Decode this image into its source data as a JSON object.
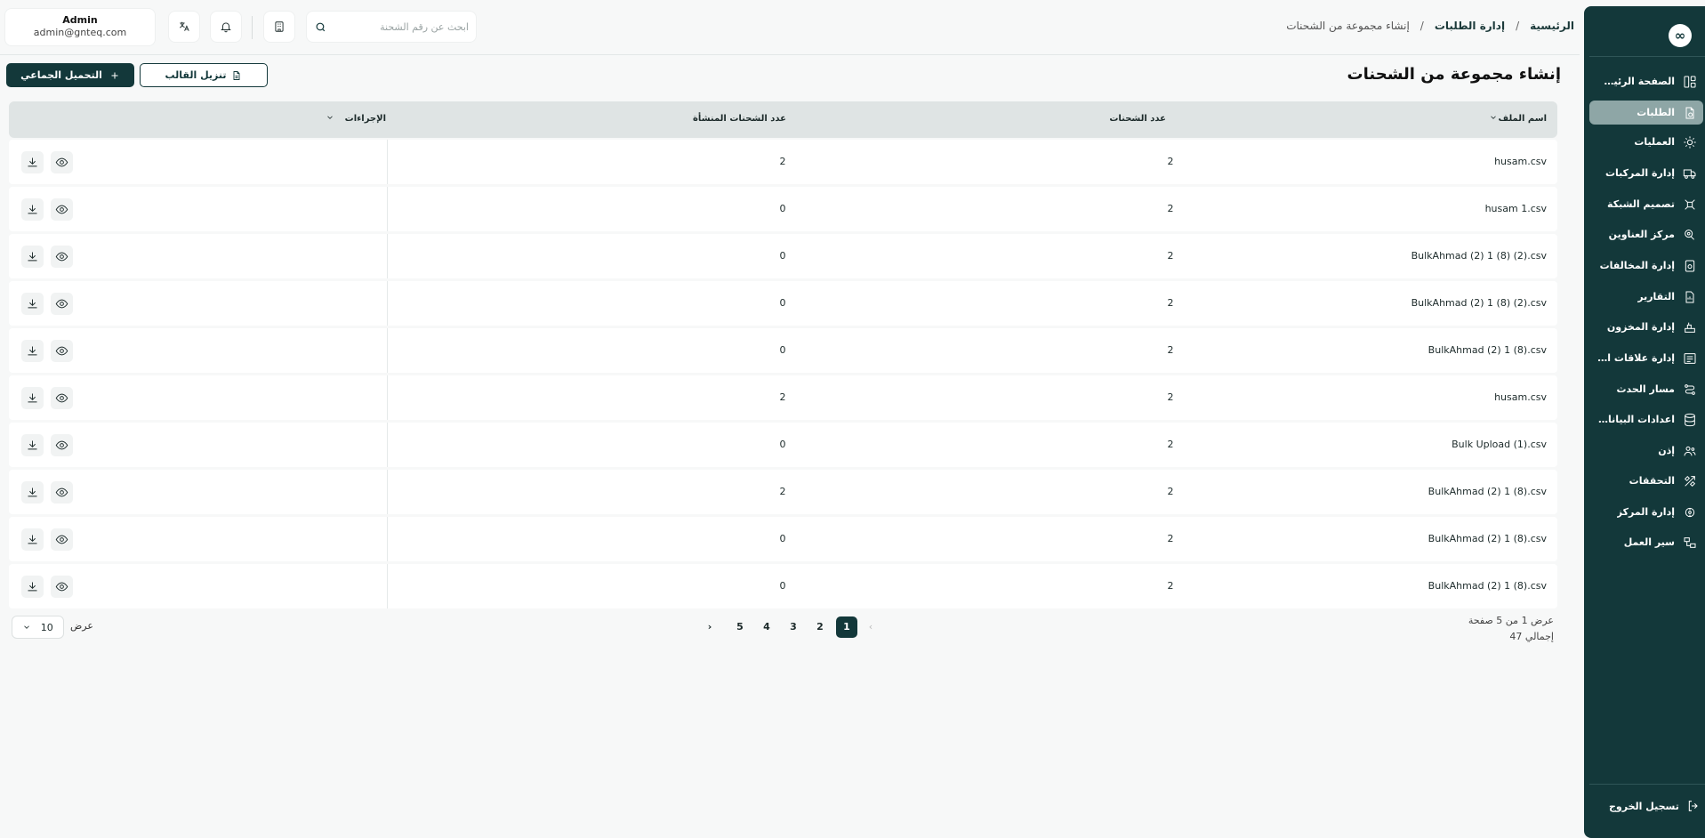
{
  "app": {
    "logo_text": "∞"
  },
  "user": {
    "name": "Admin",
    "email": "admin@gnteq.com"
  },
  "search": {
    "placeholder": "ابحث عن رقم الشحنة"
  },
  "breadcrumb": {
    "home": "الرئيسية",
    "orders": "إدارة الطلبات",
    "current": "إنشاء مجموعة من الشحنات",
    "separator": "/"
  },
  "page": {
    "title": "إنشاء مجموعة من الشحنات",
    "bulk_upload_label": "التحميل الجماعي",
    "download_template_label": "تنزيل القالب"
  },
  "sidebar": {
    "items": [
      {
        "label": "الصفحة الرئيسية",
        "icon": "dashboard-icon"
      },
      {
        "label": "الطلبات",
        "icon": "orders-icon",
        "active": true
      },
      {
        "label": "العمليات",
        "icon": "operations-icon"
      },
      {
        "label": "إدارة المركبات",
        "icon": "truck-icon"
      },
      {
        "label": "تصميم الشبكة",
        "icon": "network-icon"
      },
      {
        "label": "مركز العناوين",
        "icon": "address-icon"
      },
      {
        "label": "إدارة المخالفات",
        "icon": "violations-icon"
      },
      {
        "label": "التقارير",
        "icon": "reports-icon"
      },
      {
        "label": "إدارة المخزون",
        "icon": "inventory-icon"
      },
      {
        "label": "إدارة علاقات العملاء",
        "icon": "crm-icon"
      },
      {
        "label": "مسار الحدث",
        "icon": "event-path-icon"
      },
      {
        "label": "اعدادات البيانات...",
        "icon": "database-icon"
      },
      {
        "label": "إذن",
        "icon": "users-icon"
      },
      {
        "label": "التحققات",
        "icon": "validations-icon"
      },
      {
        "label": "إدارة المركز",
        "icon": "hub-icon"
      },
      {
        "label": "سير العمل",
        "icon": "workflow-icon"
      }
    ],
    "logout_label": "تسجيل الخروج"
  },
  "table": {
    "headers": {
      "file_name": "اسم الملف",
      "shipments_count": "عدد الشحنات",
      "created_count": "عدد الشحنات المنشأة",
      "actions": "الإجراءات"
    },
    "rows": [
      {
        "file_name": "husam.csv",
        "shipments": "2",
        "created": "2"
      },
      {
        "file_name": "husam 1.csv",
        "shipments": "2",
        "created": "0"
      },
      {
        "file_name": "BulkAhmad (2) 1 (8) (2).csv",
        "shipments": "2",
        "created": "0"
      },
      {
        "file_name": "BulkAhmad (2) 1 (8) (2).csv",
        "shipments": "2",
        "created": "0"
      },
      {
        "file_name": "BulkAhmad (2) 1 (8).csv",
        "shipments": "2",
        "created": "0"
      },
      {
        "file_name": "husam.csv",
        "shipments": "2",
        "created": "2"
      },
      {
        "file_name": "Bulk Upload (1).csv",
        "shipments": "2",
        "created": "0"
      },
      {
        "file_name": "BulkAhmad (2) 1 (8).csv",
        "shipments": "2",
        "created": "2"
      },
      {
        "file_name": "BulkAhmad (2) 1 (8).csv",
        "shipments": "2",
        "created": "0"
      },
      {
        "file_name": "BulkAhmad (2) 1 (8).csv",
        "shipments": "2",
        "created": "0"
      }
    ]
  },
  "pagination": {
    "page_info": "عرض 1 من 5 صفحة",
    "total": "إجمالي 47",
    "pages": [
      "1",
      "2",
      "3",
      "4",
      "5"
    ],
    "current": "1",
    "prev": "‹",
    "next": "›",
    "show_label": "عرض",
    "page_size": "10"
  }
}
